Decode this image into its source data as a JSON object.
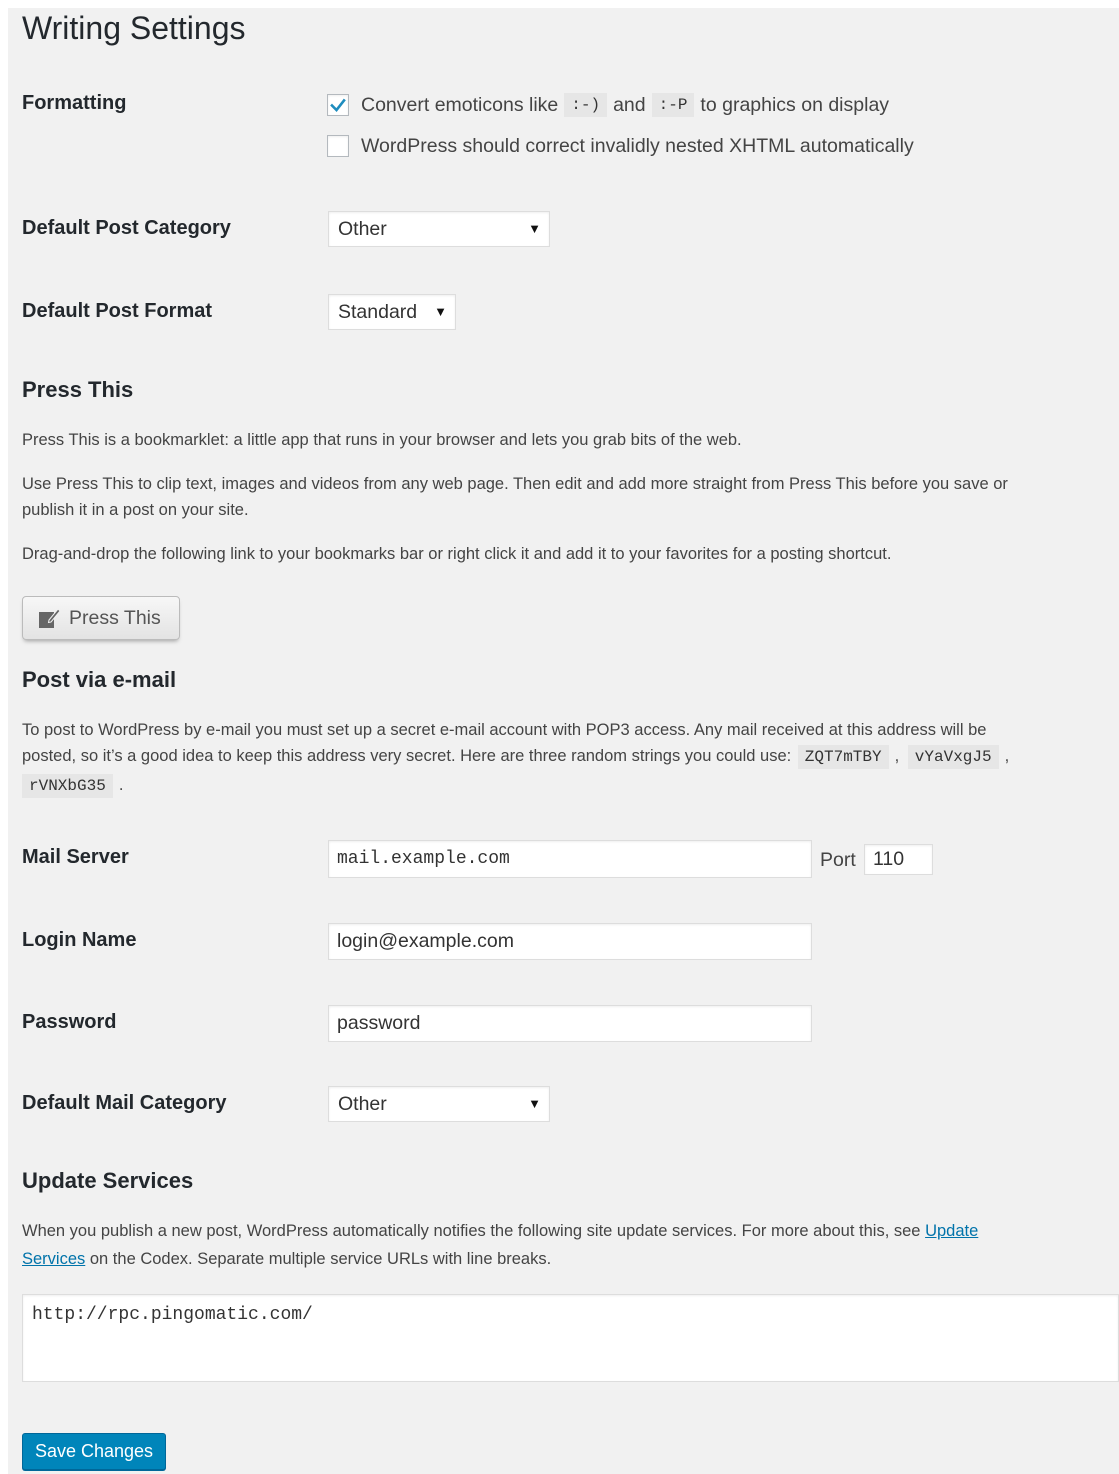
{
  "page": {
    "title": "Writing Settings"
  },
  "formatting": {
    "label": "Formatting",
    "emoticons": {
      "checked": true,
      "text_before": "Convert emoticons like",
      "code1": ":-)",
      "text_mid": "and",
      "code2": ":-P",
      "text_after": "to graphics on display"
    },
    "xhtml": {
      "checked": false,
      "text": "WordPress should correct invalidly nested XHTML automatically"
    }
  },
  "default_post_category": {
    "label": "Default Post Category",
    "value": "Other"
  },
  "default_post_format": {
    "label": "Default Post Format",
    "value": "Standard"
  },
  "press_this": {
    "title": "Press This",
    "para1": "Press This is a bookmarklet: a little app that runs in your browser and lets you grab bits of the web.",
    "para2_line1": "Use Press This to clip text, images and videos from any web page. Then edit and add more straight from Press This before you save or",
    "para2_line2": "publish it in a post on your site.",
    "para3": "Drag-and-drop the following link to your bookmarks bar or right click it and add it to your favorites for a posting shortcut.",
    "button_label": "Press This",
    "button_icon": "press-this-icon"
  },
  "post_via_email": {
    "title": "Post via e-mail",
    "line1": "To post to WordPress by e-mail you must set up a secret e-mail account with POP3 access. Any mail received at this address will be",
    "line2": "posted, so it’s a good idea to keep this address very secret. Here are three random strings you could use:",
    "random1": "ZQT7mTBY",
    "random2": "vYaVxgJ5",
    "random3": "rVNXbG35",
    "comma": ",",
    "period": "."
  },
  "mail_server": {
    "label": "Mail Server",
    "value": "mail.example.com",
    "port_label": "Port",
    "port_value": "110"
  },
  "login_name": {
    "label": "Login Name",
    "value": "login@example.com"
  },
  "password": {
    "label": "Password",
    "value": "password"
  },
  "default_mail_category": {
    "label": "Default Mail Category",
    "value": "Other"
  },
  "update_services": {
    "title": "Update Services",
    "line1_before": "When you publish a new post, WordPress automatically notifies the following site update services. For more about this, see",
    "link_part1": "Update",
    "link_part2": "Services",
    "line2_after": "on the Codex. Separate multiple service URLs with line breaks.",
    "textarea_value": "http://rpc.pingomatic.com/"
  },
  "save_button": {
    "label": "Save Changes"
  },
  "colors": {
    "accent": "#0085ba",
    "link": "#0073aa",
    "checkmark": "#1e8cbe",
    "background": "#f1f1f1"
  }
}
